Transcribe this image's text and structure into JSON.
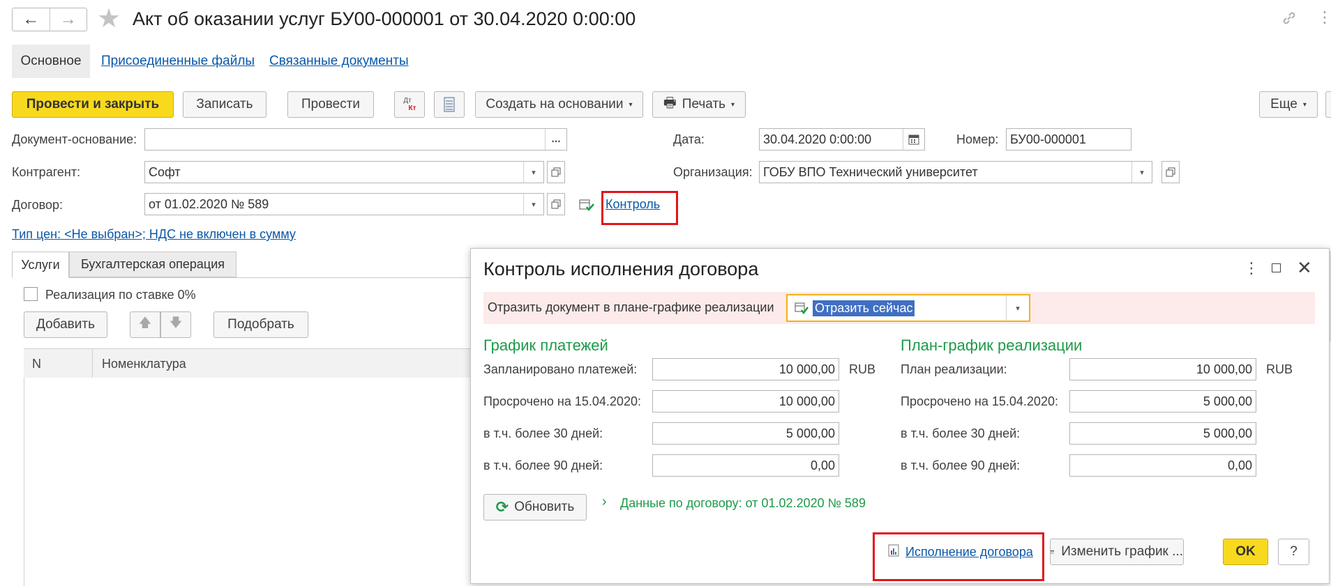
{
  "window": {
    "title": "Акт об оказании услуг БУ00-000001 от 30.04.2020 0:00:00"
  },
  "nav_tabs": [
    {
      "label": "Основное"
    },
    {
      "label": "Присоединенные файлы"
    },
    {
      "label": "Связанные документы"
    }
  ],
  "toolbar": {
    "post_close": "Провести и закрыть",
    "save": "Записать",
    "post": "Провести",
    "dtkt_top": "Дт",
    "dtkt_bottom": "Кт",
    "create_based": "Создать на основании",
    "print": "Печать",
    "more": "Еще"
  },
  "form": {
    "doc_base_label": "Документ-основание:",
    "doc_base_value": "",
    "doc_base_select": "...",
    "counterparty_label": "Контрагент:",
    "counterparty_value": "Софт",
    "contract_label": "Договор:",
    "contract_value": "от 01.02.2020 № 589",
    "control_link": "Контроль",
    "date_label": "Дата:",
    "date_value": "30.04.2020  0:00:00",
    "number_label": "Номер:",
    "number_value": "БУ00-000001",
    "org_label": "Организация:",
    "org_value": "ГОБУ ВПО Технический университет",
    "price_type_link": "Тип цен: <Не выбран>; НДС не включен в сумму"
  },
  "content_tabs": [
    {
      "label": "Услуги"
    },
    {
      "label": "Бухгалтерская операция"
    }
  ],
  "services": {
    "zero_rate_label": "Реализация по ставке 0%",
    "add": "Добавить",
    "pick": "Подобрать",
    "columns": [
      "N",
      "Номенклатура"
    ]
  },
  "dialog": {
    "title": "Контроль исполнения договора",
    "reflect_label": "Отразить документ в плане-графике реализации",
    "reflect_value": "Отразить сейчас",
    "payments": {
      "title": "График платежей",
      "rows": [
        {
          "label": "Запланировано платежей:",
          "value": "10 000,00",
          "currency": "RUB"
        },
        {
          "label": "Просрочено на 15.04.2020:",
          "value": "10 000,00"
        },
        {
          "label": "в т.ч. более 30 дней:",
          "value": "5 000,00"
        },
        {
          "label": "в т.ч. более 90 дней:",
          "value": "0,00"
        }
      ]
    },
    "sales": {
      "title": "План-график реализации",
      "rows": [
        {
          "label": "План реализации:",
          "value": "10 000,00",
          "currency": "RUB"
        },
        {
          "label": "Просрочено на 15.04.2020:",
          "value": "5 000,00"
        },
        {
          "label": "в т.ч. более 30 дней:",
          "value": "5 000,00"
        },
        {
          "label": "в т.ч. более 90 дней:",
          "value": "0,00"
        }
      ]
    },
    "refresh": "Обновить",
    "contract_data_link": "Данные по договору: от 01.02.2020 № 589",
    "execution_link": "Исполнение договора",
    "change_schedule": "Изменить график ...",
    "ok": "OK",
    "help": "?"
  },
  "colors": {
    "accent_yellow": "#f8d91e",
    "link_blue": "#0a58a8",
    "green": "#1e9a4a",
    "highlight_red": "#e3141b",
    "warning_bg": "#fdeaea"
  }
}
